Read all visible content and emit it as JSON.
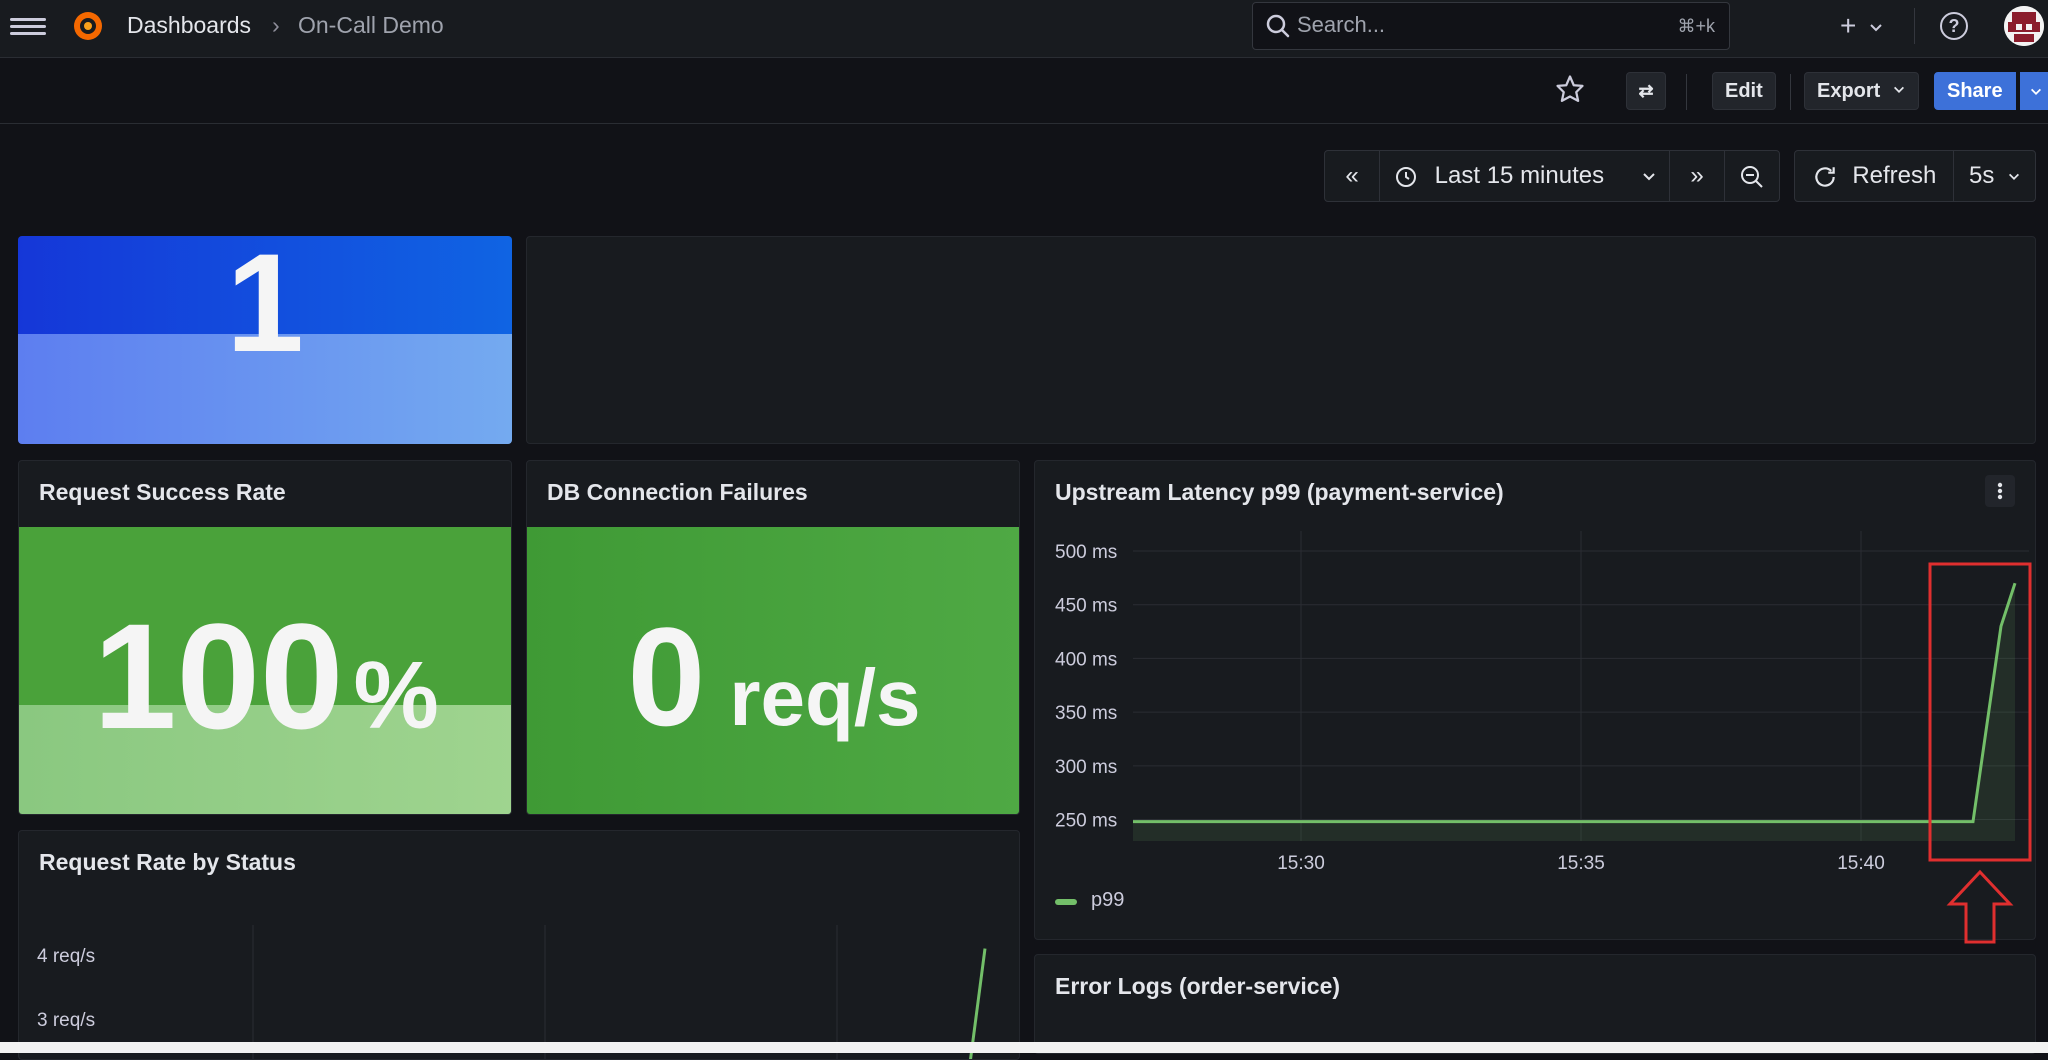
{
  "header": {
    "breadcrumb": [
      "Dashboards",
      "On-Call Demo"
    ],
    "breadcrumb_separator": "›",
    "search_placeholder": "Search...",
    "search_shortcut": "⌘+k",
    "plus_label": "+"
  },
  "toolbar": {
    "edit_label": "Edit",
    "export_label": "Export",
    "share_label": "Share"
  },
  "time_controls": {
    "range_label": "Last 15 minutes",
    "refresh_label": "Refresh",
    "interval_label": "5s"
  },
  "panels": {
    "top_stat_value": "1",
    "success_rate": {
      "title": "Request Success Rate",
      "value": "100",
      "unit": "%"
    },
    "db_failures": {
      "title": "DB Connection Failures",
      "value": "0",
      "unit": "req/s"
    },
    "latency": {
      "title": "Upstream Latency p99 (payment-service)",
      "legend": "p99"
    },
    "request_rate": {
      "title": "Request Rate by Status"
    },
    "error_logs": {
      "title": "Error Logs (order-service)"
    }
  },
  "colors": {
    "accent": "#3d71d9",
    "stat_green": "#4aa23a",
    "series_green": "#73bf69",
    "highlight_red": "#e02f2f"
  },
  "chart_data": [
    {
      "type": "line",
      "title": "Upstream Latency p99 (payment-service)",
      "xlabel": "",
      "ylabel": "",
      "x": [
        "15:27",
        "15:30",
        "15:35",
        "15:40",
        "15:42",
        "15:42:30",
        "15:42:45"
      ],
      "series": [
        {
          "name": "p99",
          "values": [
            248,
            248,
            248,
            248,
            248,
            430,
            470
          ]
        }
      ],
      "ylim": [
        230,
        500
      ],
      "y_ticks": [
        "500 ms",
        "450 ms",
        "400 ms",
        "350 ms",
        "300 ms",
        "250 ms"
      ],
      "x_ticks": [
        "15:30",
        "15:35",
        "15:40"
      ],
      "grid": true,
      "legend": "bottom-left"
    },
    {
      "type": "line",
      "title": "Request Rate by Status",
      "y_ticks": [
        "4 req/s",
        "3 req/s"
      ],
      "series": [
        {
          "values": [
            0,
            0,
            0,
            0,
            4.1
          ]
        }
      ],
      "grid": true
    }
  ]
}
